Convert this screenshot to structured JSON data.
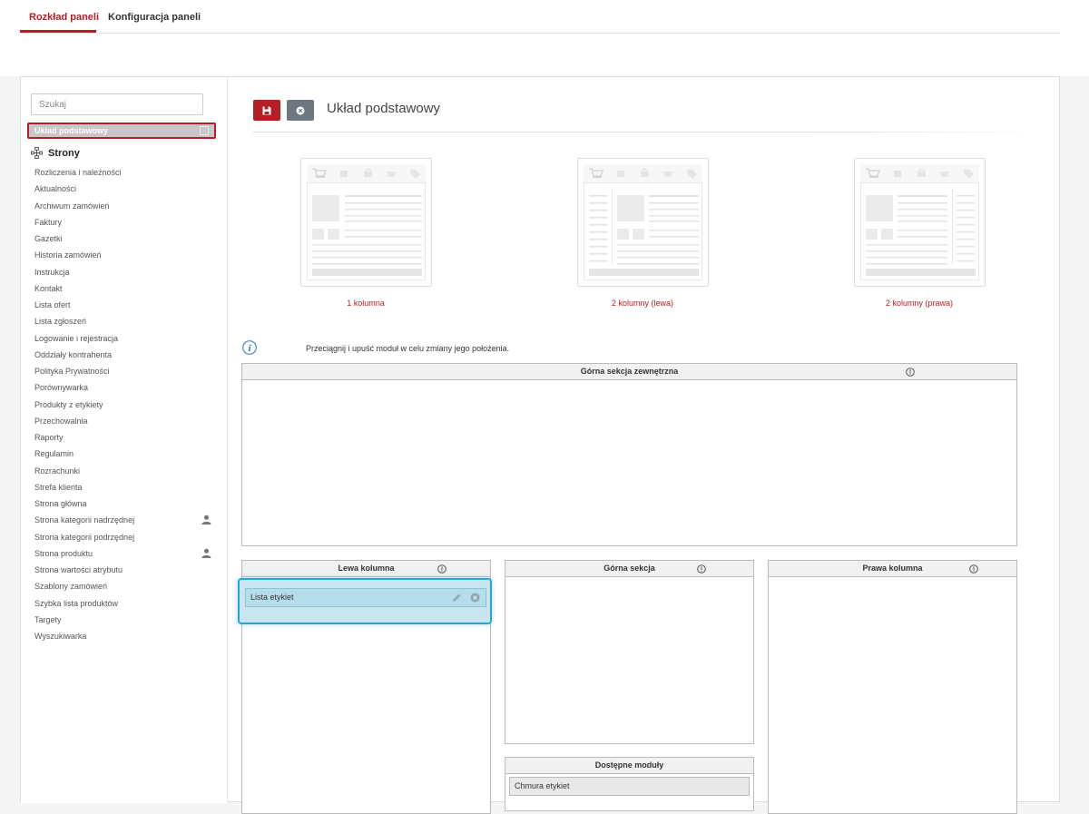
{
  "tabs": [
    {
      "label": "Rozkład paneli",
      "active": true
    },
    {
      "label": "Konfiguracja paneli",
      "active": false
    }
  ],
  "sidebar": {
    "search_placeholder": "Szukaj",
    "selected_layout": "Układ podstawowy",
    "group_label": "Strony",
    "pages": [
      {
        "label": "Rozliczenia i należności"
      },
      {
        "label": "Aktualności"
      },
      {
        "label": "Archiwum zamówień"
      },
      {
        "label": "Faktury"
      },
      {
        "label": "Gazetki"
      },
      {
        "label": "Historia zamówień"
      },
      {
        "label": "Instrukcja"
      },
      {
        "label": "Kontakt"
      },
      {
        "label": "Lista ofert"
      },
      {
        "label": "Lista zgłoszeń"
      },
      {
        "label": "Logowanie i rejestracja"
      },
      {
        "label": "Oddziały kontrahenta"
      },
      {
        "label": "Polityka Prywatności"
      },
      {
        "label": "Porównywarka"
      },
      {
        "label": "Produkty z etykiety"
      },
      {
        "label": "Przechowalnia"
      },
      {
        "label": "Raporty"
      },
      {
        "label": "Regulamin"
      },
      {
        "label": "Rozrachunki"
      },
      {
        "label": "Strefa klienta"
      },
      {
        "label": "Strona główna"
      },
      {
        "label": "Strona kategorii nadrzędnej",
        "icon": "user-icon"
      },
      {
        "label": "Strona kategorii podrzędnej"
      },
      {
        "label": "Strona produktu",
        "icon": "user-icon"
      },
      {
        "label": "Strona wartości atrybutu"
      },
      {
        "label": "Szablony zamówień"
      },
      {
        "label": "Szybka lista produktów"
      },
      {
        "label": "Targety"
      },
      {
        "label": "Wyszukiwarka"
      }
    ]
  },
  "editor": {
    "title": "Układ podstawowy",
    "layouts": [
      {
        "label": "1 kolumna"
      },
      {
        "label": "2 kolumny (lewa)"
      },
      {
        "label": "2 kolumny (prawa)"
      }
    ],
    "hint": "Przeciągnij i upuść moduł w celu zmiany jego położenia.",
    "sections": {
      "top_outer": "Górna sekcja zewnętrzna",
      "left_column": "Lewa kolumna",
      "top_section": "Górna sekcja",
      "right_column": "Prawa kolumna",
      "available_modules": "Dostępne moduły"
    },
    "left_column_modules": [
      "Lista etykiet"
    ],
    "available_modules_list": [
      "Chmura etykiet"
    ]
  },
  "colors": {
    "accent": "#b41f25",
    "highlight": "#26a5d8",
    "cancel_button": "#6e7781"
  }
}
